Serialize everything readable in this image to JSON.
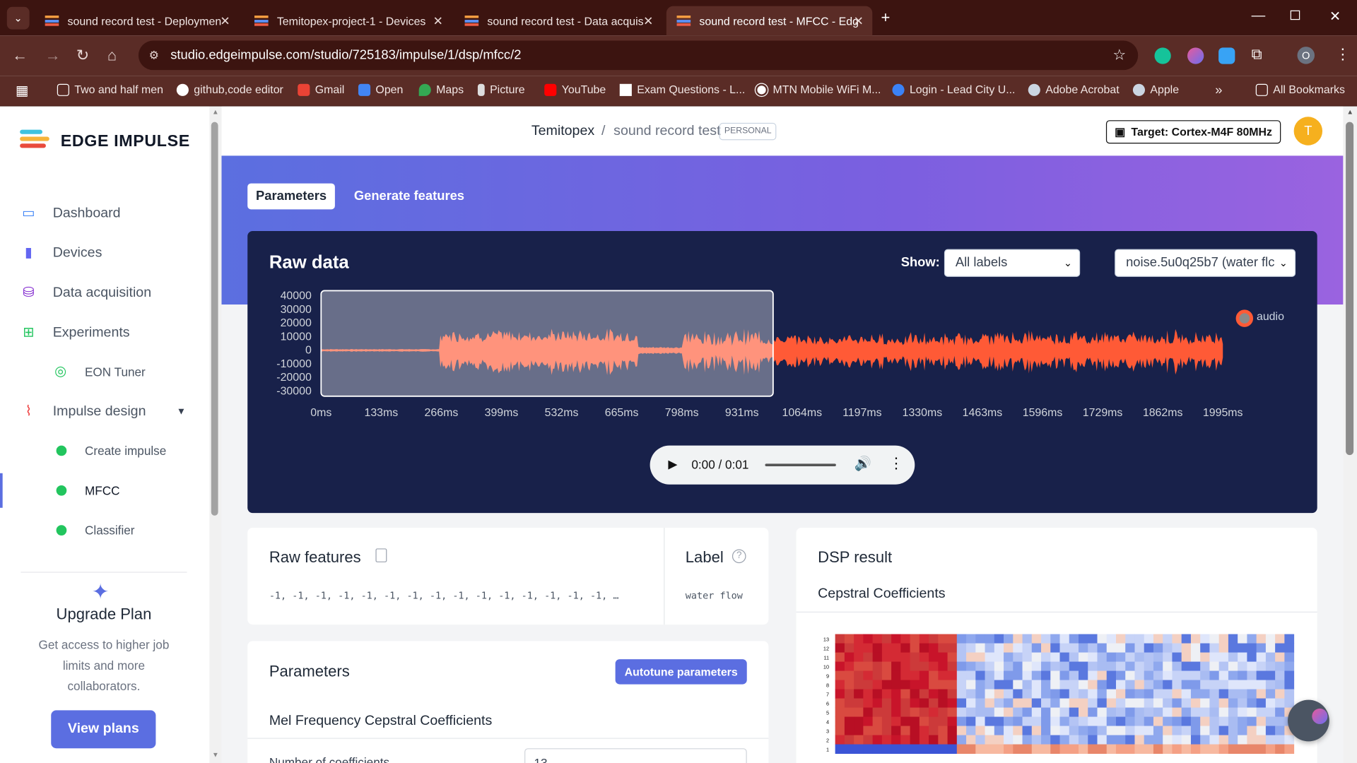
{
  "browser": {
    "tabs": [
      {
        "title": "sound record test - Deploymen"
      },
      {
        "title": "Temitopex-project-1 - Devices"
      },
      {
        "title": "sound record test - Data acquis"
      },
      {
        "title": "sound record test - MFCC - Edg"
      }
    ],
    "url": "studio.edgeimpulse.com/studio/725183/impulse/1/dsp/mfcc/2",
    "profile_initial": "O",
    "bookmarks": [
      "Two and half men",
      "github,code editor",
      "Gmail",
      "Open",
      "Maps",
      "Picture",
      "YouTube",
      "Exam Questions - L...",
      "MTN Mobile WiFi M...",
      "Login - Lead City U...",
      "Adobe Acrobat",
      "Apple"
    ],
    "more_bookmarks": "»",
    "all_bookmarks": "All Bookmarks"
  },
  "sidebar": {
    "logo": "EDGE IMPULSE",
    "items": [
      {
        "label": "Dashboard",
        "icon": "monitor-icon"
      },
      {
        "label": "Devices",
        "icon": "chip-icon"
      },
      {
        "label": "Data acquisition",
        "icon": "database-icon"
      },
      {
        "label": "Experiments",
        "icon": "grid-icon"
      },
      {
        "label": "EON Tuner",
        "icon": "compass-icon"
      },
      {
        "label": "Impulse design",
        "icon": "pulse-icon"
      },
      {
        "label": "Create impulse"
      },
      {
        "label": "MFCC"
      },
      {
        "label": "Classifier"
      }
    ],
    "upgrade": {
      "title": "Upgrade Plan",
      "text": "Get access to higher job limits and more collaborators.",
      "button": "View plans"
    }
  },
  "header": {
    "user": "Temitopex",
    "separator": "/",
    "project": "sound record test",
    "badge": "PERSONAL",
    "target": "Target: Cortex-M4F 80MHz",
    "avatar": "T"
  },
  "tabs": {
    "parameters": "Parameters",
    "generate": "Generate features"
  },
  "raw_data": {
    "title": "Raw data",
    "show_label": "Show:",
    "show_value": "All labels",
    "sample_value": "noise.5u0q25b7 (water flc",
    "legend": "audio",
    "player_time": "0:00 / 0:01"
  },
  "chart_data": {
    "type": "line",
    "series": [
      {
        "name": "audio",
        "color": "#ff5a36"
      }
    ],
    "y_ticks": [
      "40000",
      "30000",
      "20000",
      "10000",
      "0",
      "-10000",
      "-20000",
      "-30000"
    ],
    "x_ticks": [
      "0ms",
      "133ms",
      "266ms",
      "399ms",
      "532ms",
      "665ms",
      "798ms",
      "931ms",
      "1064ms",
      "1197ms",
      "1330ms",
      "1463ms",
      "1596ms",
      "1729ms",
      "1862ms",
      "1995ms"
    ],
    "ylim": [
      -30000,
      40000
    ],
    "xlim": [
      0,
      1995
    ],
    "window_ms": [
      0,
      1000
    ]
  },
  "raw_features": {
    "title": "Raw features",
    "values": "-1, -1, -1, -1, -1, -1, -1, -1, -1, -1, -1, -1, -1, -1, -1, …"
  },
  "label": {
    "title": "Label",
    "value": "water flow"
  },
  "dsp": {
    "title": "DSP result",
    "subtitle": "Cepstral Coefficients",
    "row_labels": [
      "13",
      "12",
      "11",
      "10",
      "9",
      "8",
      "7",
      "6",
      "5",
      "4",
      "3",
      "2",
      "1"
    ]
  },
  "parameters": {
    "title": "Parameters",
    "autotune": "Autotune parameters",
    "section": "Mel Frequency Cepstral Coefficients",
    "field_label": "Number of coefficients",
    "field_value": "13"
  },
  "colors": {
    "accent": "#5b6ee1",
    "wave": "#ff5a36",
    "wave_window": "#ff8a66",
    "raw_bg": "#18214a"
  }
}
